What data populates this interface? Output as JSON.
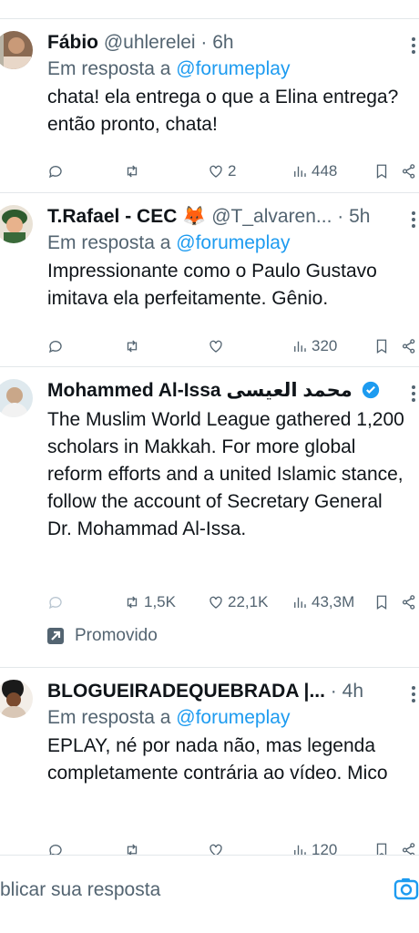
{
  "tweets": [
    {
      "name": "Fábio",
      "handle": "@uhlerelei",
      "dot": "·",
      "time": "6h",
      "reply_prefix": "Em resposta a",
      "reply_to": "@forumeplay",
      "text": "chata! ela entrega o que a Elina entrega? então pronto, chata!",
      "stats": {
        "replies": "",
        "retweets": "",
        "likes": "2",
        "views": "448"
      }
    },
    {
      "name": "T.Rafael - CEC",
      "name_emoji": "🦊",
      "handle": "@T_alvaren...",
      "dot": "·",
      "time": "5h",
      "reply_prefix": "Em resposta a",
      "reply_to": "@forumeplay",
      "text": "Impressionante como o Paulo Gustavo imitava ela perfeitamente. Gênio.",
      "stats": {
        "replies": "",
        "retweets": "",
        "likes": "",
        "views": "320"
      }
    },
    {
      "name": "Mohammed Al-Issa محمد العيسى",
      "text": "The Muslim World League gathered 1,200 scholars in Makkah. For more global reform efforts and a united Islamic stance, follow the account of Secretary General Dr. Mohammad Al-Issa.",
      "stats": {
        "replies": "",
        "retweets": "1,5K",
        "likes": "22,1K",
        "views": "43,3M"
      },
      "promoted_label": "Promovido"
    },
    {
      "name": "BLOGUEIRADEQUEBRADA |...",
      "dot": "·",
      "time": "4h",
      "reply_prefix": "Em resposta a",
      "reply_to": "@forumeplay",
      "text": "EPLAY, né por nada não, mas legenda completamente contrária ao vídeo. Mico",
      "stats": {
        "replies": "",
        "retweets": "",
        "likes": "",
        "views": "120"
      }
    }
  ],
  "composer": {
    "placeholder": "blicar sua resposta"
  },
  "colors": {
    "accent": "#1d9bf0",
    "muted": "#536471",
    "text": "#0f1419",
    "divider": "#e3e7ea"
  }
}
